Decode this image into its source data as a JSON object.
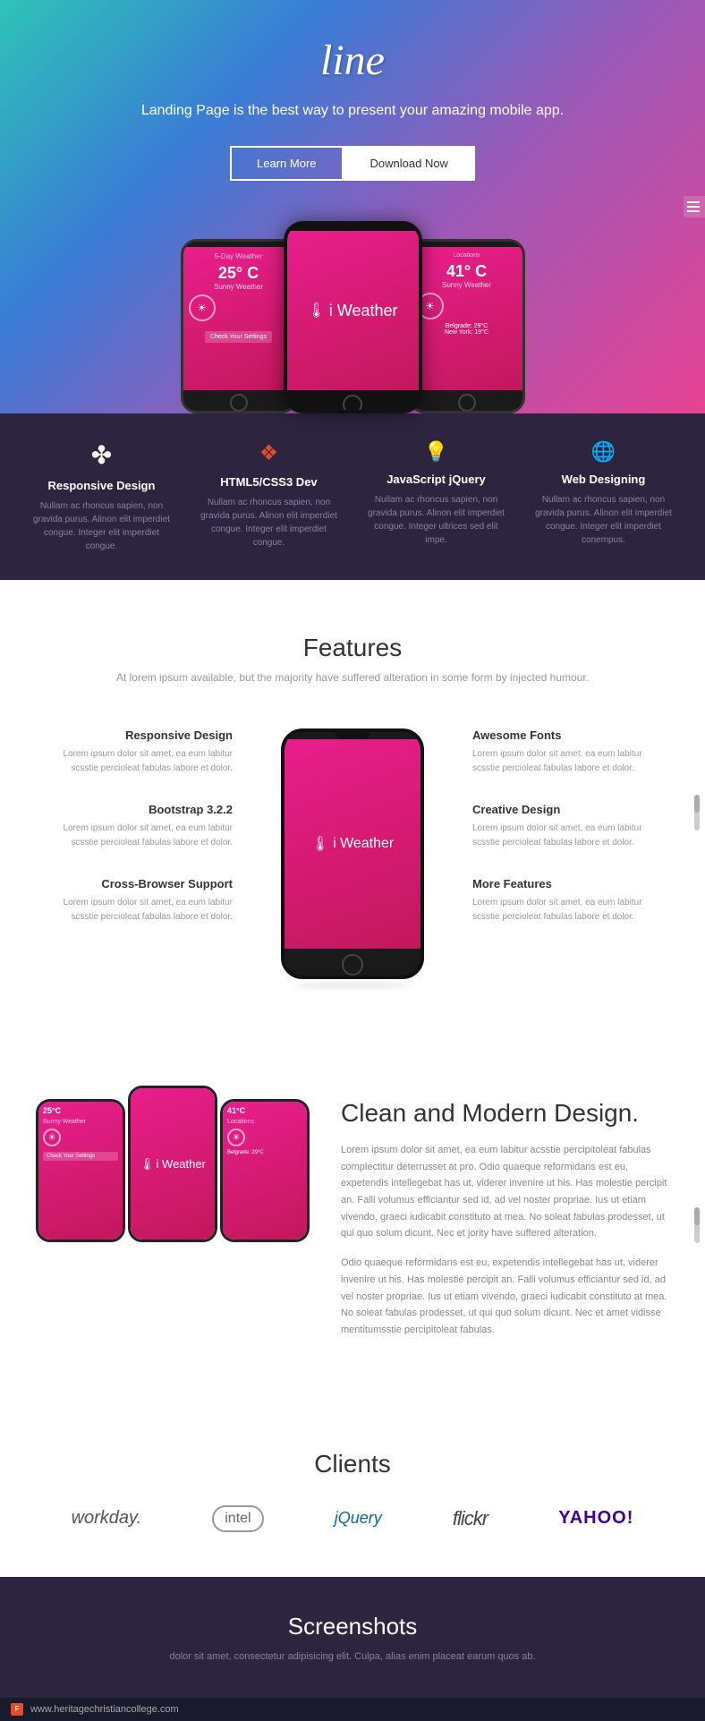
{
  "hero": {
    "title": "line",
    "subtitle": "Landing Page is the best way to present your amazing mobile app.",
    "btn_learn": "Learn More",
    "btn_download": "Download Now"
  },
  "features_strip": {
    "items": [
      {
        "icon": "✤",
        "title": "Responsive Design",
        "desc": "Nullam ac rhoncus sapien, non gravida purus. Alinon elit imperdiet congue. Integer elit imperdiet congue."
      },
      {
        "icon": "❑",
        "title": "HTML5/CSS3 Dev",
        "desc": "Nullam ac rhoncus sapien, non gravida purus. Alinon elit imperdiet congue. Integer elit imperdiet congue."
      },
      {
        "icon": "💡",
        "title": "JavaScript jQuery",
        "desc": "Nullam ac rhoncus sapien, non gravida purus. Alinon elit imperdiet congue. Integer ultrices sed elit impe."
      },
      {
        "icon": "🌐",
        "title": "Web Designing",
        "desc": "Nullam ac rhoncus sapien, non gravida purus. Alinon elit imperdiet congue. Integer elit imperdiet conempus."
      }
    ]
  },
  "main_features": {
    "title": "Features",
    "subtitle": "At lorem ipsum available, but the majority have suffered alteration in some form by injected humour.",
    "left_features": [
      {
        "title": "Responsive Design",
        "desc": "Lorem ipsum dolor sit amet, ea eum labitur scsstie percioleat fabulas labore et dolor."
      },
      {
        "title": "Bootstrap 3.2.2",
        "desc": "Lorem ipsum dolor sit amet, ea eum labitur scsstie percioleat fabulas labore et dolor."
      },
      {
        "title": "Cross-Browser Support",
        "desc": "Lorem ipsum dolor sit amet, ea eum labitur scsstie percioleat fabulas labore et dolor."
      }
    ],
    "right_features": [
      {
        "title": "Awesome Fonts",
        "desc": "Lorem ipsum dolor sit amet, ea eum labitur scsstie percioleat fabulas labore et dolor."
      },
      {
        "title": "Creative Design",
        "desc": "Lorem ipsum dolor sit amet, ea eum labitur scsstie percioleat fabulas labore et dolor."
      },
      {
        "title": "More Features",
        "desc": "Lorem ipsum dolor sit amet, ea eum labitur scsstie percioleat fabulas labore et dolor."
      }
    ]
  },
  "clean_design": {
    "title": "Clean and Modern Design.",
    "paragraph1": "Lorem ipsum dolor sit amet, ea eum labitur acsstie percipitoleat fabulas complectitur deterrusset at pro. Odio quaeque reformidans est eu, expetendis intellegebat has ut, viderer invenire ut his. Has molestie percipit an. Falli volumus efficiantur sed id, ad vel noster propriae. Ius ut etiam vivendo, graeci iudicabit constituto at mea. No soleat fabulas prodesset, ut qui quo solum dicunt. Nec et jority have suffered alteration.",
    "paragraph2": "Odio quaeque reformidans est eu, expetendis intellegebat has ut, viderer invenire ut his. Has molestie percipit an. Falli volumus efficiantur sed id, ad vel noster propriae. Ius ut etiam vivendo, graeci iudicabit constituto at mea. No soleat fabulas prodesset, ut qui quo solum dicunt. Nec et amet vidisse mentitumsstie percipitoleat fabulas."
  },
  "clients": {
    "title": "Clients",
    "logos": [
      "workday.",
      "intel",
      "jQuery",
      "flickr",
      "YAHOO!"
    ]
  },
  "screenshots": {
    "title": "Screenshots",
    "desc": "dolor sit amet, consectetur adipisicing elit. Culpa, alias enim placeat earum quos ab."
  },
  "footer": {
    "url": "www.heritagechristiancollege.com"
  },
  "iweather_logo": "i Weather",
  "weather_data": {
    "temp": "25° C",
    "desc": "Sunny Weather",
    "btn_label": "Check Your Settings",
    "temp2": "41° C"
  }
}
